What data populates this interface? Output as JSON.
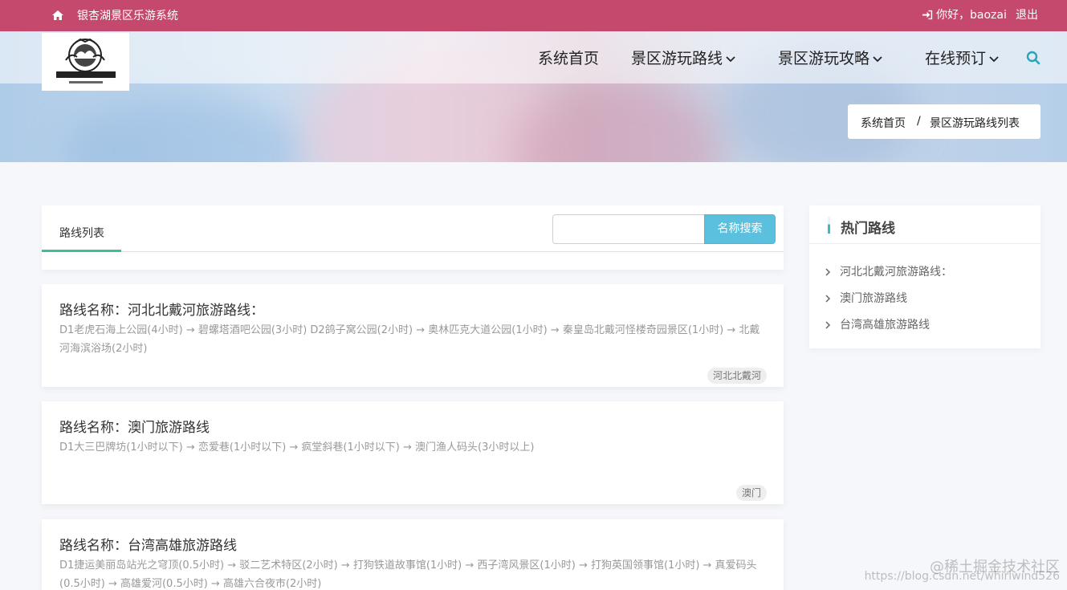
{
  "topbar": {
    "title": "银杏湖景区乐游系统",
    "greeting": "你好，baozai",
    "logout": "退出",
    "home_icon": "home-icon",
    "login_icon": "sign-in-icon"
  },
  "nav": {
    "items": [
      {
        "label": "系统首页",
        "has_dropdown": false
      },
      {
        "label": "景区游玩路线",
        "has_dropdown": true
      },
      {
        "label": "景区游玩攻略",
        "has_dropdown": true
      },
      {
        "label": "在线预订",
        "has_dropdown": true
      }
    ],
    "search_icon": "search-icon"
  },
  "breadcrumb": {
    "home": "系统首页",
    "separator": "/",
    "current": "景区游玩路线列表"
  },
  "list": {
    "tab_label": "路线列表",
    "search_placeholder": "",
    "search_button": "名称搜索"
  },
  "routes": [
    {
      "name": "路线名称：河北北戴河旅游路线：",
      "description": "D1老虎石海上公园(4小时) → 碧螺塔酒吧公园(3小时) D2鸽子窝公园(2小时) → 奥林匹克大道公园(1小时) → 秦皇岛北戴河怪楼奇园景区(1小时) → 北戴河海滨浴场(2小时)",
      "tag": "河北北戴河"
    },
    {
      "name": "路线名称：澳门旅游路线",
      "description": "D1大三巴牌坊(1小时以下) → 恋爱巷(1小时以下) → 疯堂斜巷(1小时以下) → 澳门渔人码头(3小时以上)",
      "tag": "澳门"
    },
    {
      "name": "路线名称：台湾高雄旅游路线",
      "description": "D1捷运美丽岛站光之穹顶(0.5小时) → 驳二艺术特区(2小时) → 打狗铁道故事馆(1小时) → 西子湾风景区(1小时) → 打狗英国领事馆(1小时) → 真爱码头(0.5小时) → 高雄爱河(0.5小时) → 高雄六合夜市(2小时)",
      "tag": ""
    }
  ],
  "hot_routes": {
    "title": "热门路线",
    "items": [
      "河北北戴河旅游路线：",
      "澳门旅游路线",
      "台湾高雄旅游路线"
    ]
  },
  "watermark": {
    "line1": "@稀土掘金技术社区",
    "line2": "https://blog.csdn.net/whirlwind526"
  },
  "colors": {
    "topbar": "#c4496c",
    "search_button": "#5bc0de",
    "tab_underline": "#3cbf9a",
    "hot_accent": "#3fb7c6"
  }
}
